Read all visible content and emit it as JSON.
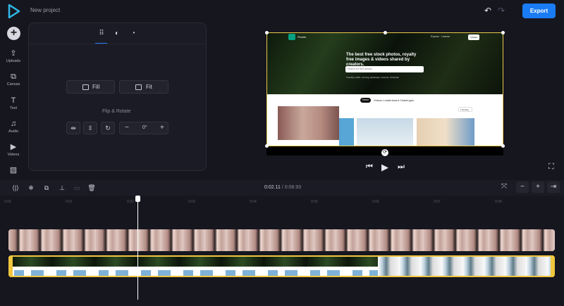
{
  "header": {
    "project_title": "New project",
    "export_label": "Export",
    "accent": "#1a7cf5"
  },
  "rail": {
    "items": [
      {
        "label": "Uploads",
        "icon": "upload-icon"
      },
      {
        "label": "Canvas",
        "icon": "canvas-icon"
      },
      {
        "label": "Text",
        "icon": "text-icon"
      },
      {
        "label": "Audio",
        "icon": "music-icon"
      },
      {
        "label": "Videos",
        "icon": "video-icon"
      },
      {
        "label": "",
        "icon": "image-icon"
      }
    ]
  },
  "panel": {
    "fill_label": "Fill",
    "fit_label": "Fit",
    "flip_rotate_label": "Flip & Rotate",
    "rotation_value": "0°"
  },
  "preview": {
    "brand": "Pexels",
    "headline": "The best free stock photos, royalty free images & videos shared by creators.",
    "search_placeholder": "Search for free photos",
    "trending": "Trending: 2024, morning, landscape, summer, christmas",
    "nav": "Explore  ·  License",
    "upload_label": "Upload",
    "tab_home": "Home",
    "tabs_rest": "Videos   Leaderboard   Challenges",
    "trending_select": "Trending"
  },
  "timeline": {
    "current_time": "0:02.11",
    "separator": " / ",
    "total_time": "0:08.93",
    "ticks": [
      "0:00",
      "0:01",
      "0:02",
      "0:03",
      "0:04",
      "0:05",
      "0:06",
      "0:07",
      "0:08"
    ]
  }
}
